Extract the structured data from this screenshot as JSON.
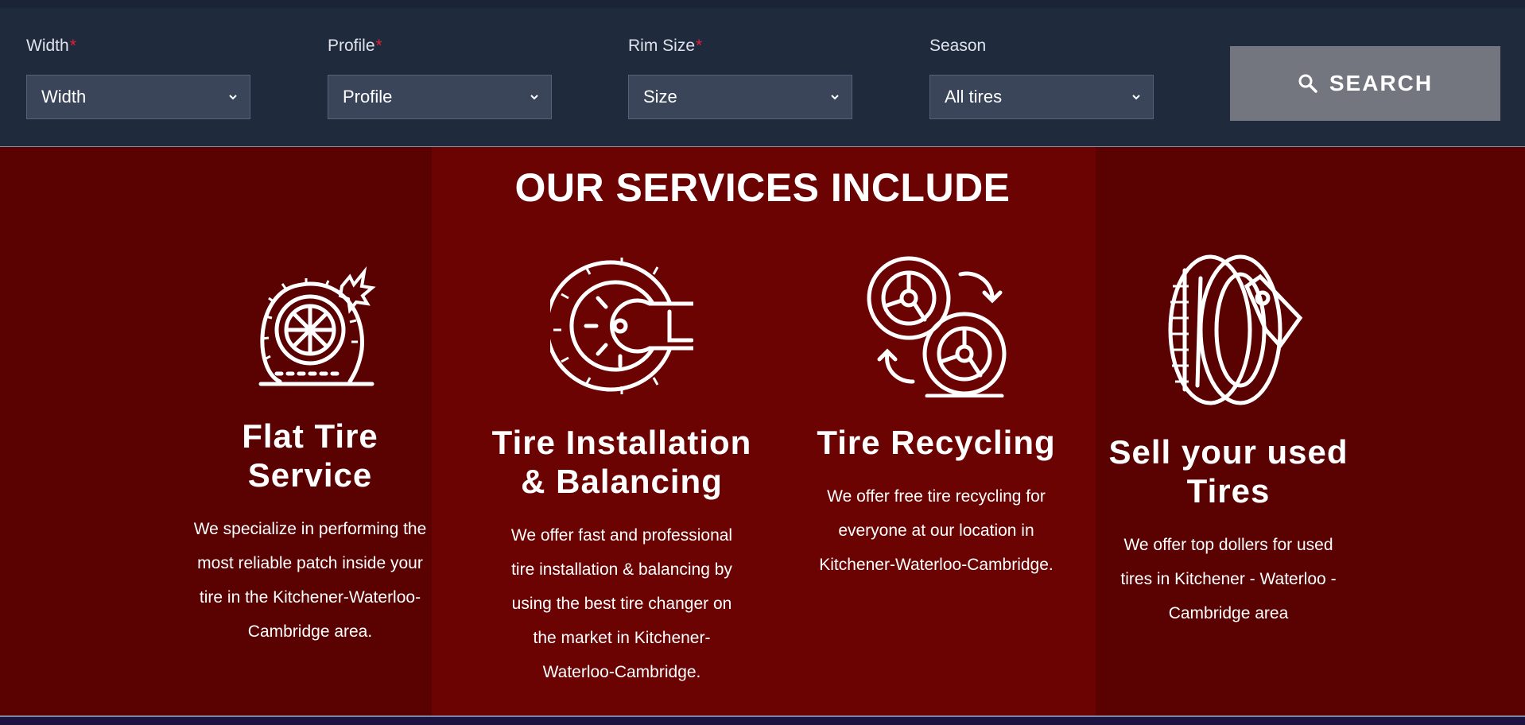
{
  "search": {
    "fields": [
      {
        "label": "Width",
        "required": true,
        "value": "Width"
      },
      {
        "label": "Profile",
        "required": true,
        "value": "Profile"
      },
      {
        "label": "Rim Size",
        "required": true,
        "value": "Size"
      },
      {
        "label": "Season",
        "required": false,
        "value": "All tires"
      }
    ],
    "button_label": "SEARCH"
  },
  "services": {
    "title": "OUR SERVICES INCLUDE",
    "items": [
      {
        "icon": "flat-tire-icon",
        "title_line1": "Flat Tire",
        "title_line2": "Service",
        "desc": [
          "We specialize in performing the",
          "most reliable patch inside your",
          "tire in the Kitchener-Waterloo-",
          "Cambridge area."
        ]
      },
      {
        "icon": "tire-wrench-icon",
        "title_line1": "Tire Installation",
        "title_line2": "& Balancing",
        "desc": [
          "We offer fast and professional",
          "tire installation & balancing by",
          "using the best tire changer on",
          "the market in Kitchener-",
          "Waterloo-Cambridge."
        ]
      },
      {
        "icon": "tire-recycling-icon",
        "title_line1": "Tire Recycling",
        "title_line2": "",
        "desc": [
          "We offer free tire recycling for",
          "everyone at our location in",
          "Kitchener-Waterloo-Cambridge."
        ]
      },
      {
        "icon": "tire-price-tag-icon",
        "title_line1": "Sell your used",
        "title_line2": "Tires",
        "desc": [
          "We offer top dollers for used",
          "tires in Kitchener - Waterloo -",
          "Cambridge area"
        ]
      }
    ]
  }
}
